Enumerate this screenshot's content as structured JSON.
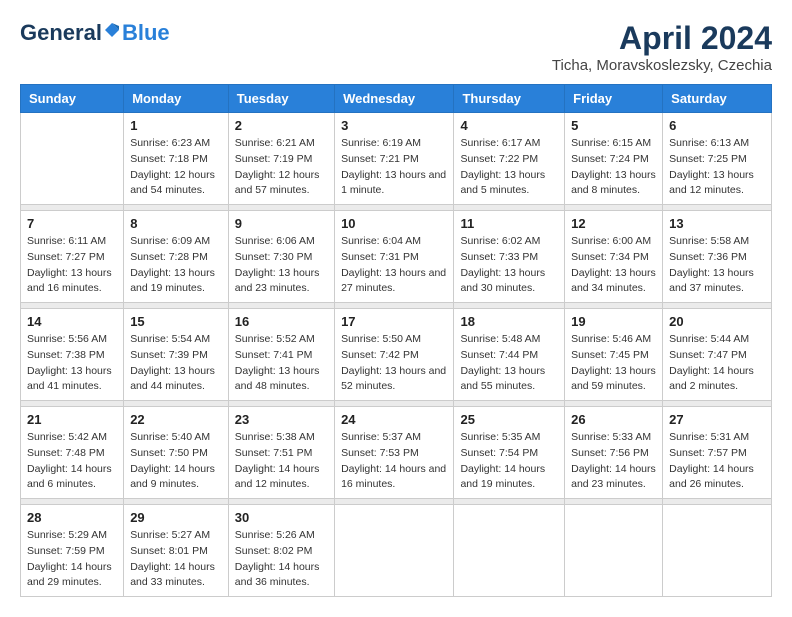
{
  "header": {
    "logo_general": "General",
    "logo_blue": "Blue",
    "month_title": "April 2024",
    "location": "Ticha, Moravskoslezsky, Czechia"
  },
  "days_of_week": [
    "Sunday",
    "Monday",
    "Tuesday",
    "Wednesday",
    "Thursday",
    "Friday",
    "Saturday"
  ],
  "weeks": [
    {
      "days": [
        {
          "number": "",
          "sunrise": "",
          "sunset": "",
          "daylight": ""
        },
        {
          "number": "1",
          "sunrise": "Sunrise: 6:23 AM",
          "sunset": "Sunset: 7:18 PM",
          "daylight": "Daylight: 12 hours and 54 minutes."
        },
        {
          "number": "2",
          "sunrise": "Sunrise: 6:21 AM",
          "sunset": "Sunset: 7:19 PM",
          "daylight": "Daylight: 12 hours and 57 minutes."
        },
        {
          "number": "3",
          "sunrise": "Sunrise: 6:19 AM",
          "sunset": "Sunset: 7:21 PM",
          "daylight": "Daylight: 13 hours and 1 minute."
        },
        {
          "number": "4",
          "sunrise": "Sunrise: 6:17 AM",
          "sunset": "Sunset: 7:22 PM",
          "daylight": "Daylight: 13 hours and 5 minutes."
        },
        {
          "number": "5",
          "sunrise": "Sunrise: 6:15 AM",
          "sunset": "Sunset: 7:24 PM",
          "daylight": "Daylight: 13 hours and 8 minutes."
        },
        {
          "number": "6",
          "sunrise": "Sunrise: 6:13 AM",
          "sunset": "Sunset: 7:25 PM",
          "daylight": "Daylight: 13 hours and 12 minutes."
        }
      ]
    },
    {
      "days": [
        {
          "number": "7",
          "sunrise": "Sunrise: 6:11 AM",
          "sunset": "Sunset: 7:27 PM",
          "daylight": "Daylight: 13 hours and 16 minutes."
        },
        {
          "number": "8",
          "sunrise": "Sunrise: 6:09 AM",
          "sunset": "Sunset: 7:28 PM",
          "daylight": "Daylight: 13 hours and 19 minutes."
        },
        {
          "number": "9",
          "sunrise": "Sunrise: 6:06 AM",
          "sunset": "Sunset: 7:30 PM",
          "daylight": "Daylight: 13 hours and 23 minutes."
        },
        {
          "number": "10",
          "sunrise": "Sunrise: 6:04 AM",
          "sunset": "Sunset: 7:31 PM",
          "daylight": "Daylight: 13 hours and 27 minutes."
        },
        {
          "number": "11",
          "sunrise": "Sunrise: 6:02 AM",
          "sunset": "Sunset: 7:33 PM",
          "daylight": "Daylight: 13 hours and 30 minutes."
        },
        {
          "number": "12",
          "sunrise": "Sunrise: 6:00 AM",
          "sunset": "Sunset: 7:34 PM",
          "daylight": "Daylight: 13 hours and 34 minutes."
        },
        {
          "number": "13",
          "sunrise": "Sunrise: 5:58 AM",
          "sunset": "Sunset: 7:36 PM",
          "daylight": "Daylight: 13 hours and 37 minutes."
        }
      ]
    },
    {
      "days": [
        {
          "number": "14",
          "sunrise": "Sunrise: 5:56 AM",
          "sunset": "Sunset: 7:38 PM",
          "daylight": "Daylight: 13 hours and 41 minutes."
        },
        {
          "number": "15",
          "sunrise": "Sunrise: 5:54 AM",
          "sunset": "Sunset: 7:39 PM",
          "daylight": "Daylight: 13 hours and 44 minutes."
        },
        {
          "number": "16",
          "sunrise": "Sunrise: 5:52 AM",
          "sunset": "Sunset: 7:41 PM",
          "daylight": "Daylight: 13 hours and 48 minutes."
        },
        {
          "number": "17",
          "sunrise": "Sunrise: 5:50 AM",
          "sunset": "Sunset: 7:42 PM",
          "daylight": "Daylight: 13 hours and 52 minutes."
        },
        {
          "number": "18",
          "sunrise": "Sunrise: 5:48 AM",
          "sunset": "Sunset: 7:44 PM",
          "daylight": "Daylight: 13 hours and 55 minutes."
        },
        {
          "number": "19",
          "sunrise": "Sunrise: 5:46 AM",
          "sunset": "Sunset: 7:45 PM",
          "daylight": "Daylight: 13 hours and 59 minutes."
        },
        {
          "number": "20",
          "sunrise": "Sunrise: 5:44 AM",
          "sunset": "Sunset: 7:47 PM",
          "daylight": "Daylight: 14 hours and 2 minutes."
        }
      ]
    },
    {
      "days": [
        {
          "number": "21",
          "sunrise": "Sunrise: 5:42 AM",
          "sunset": "Sunset: 7:48 PM",
          "daylight": "Daylight: 14 hours and 6 minutes."
        },
        {
          "number": "22",
          "sunrise": "Sunrise: 5:40 AM",
          "sunset": "Sunset: 7:50 PM",
          "daylight": "Daylight: 14 hours and 9 minutes."
        },
        {
          "number": "23",
          "sunrise": "Sunrise: 5:38 AM",
          "sunset": "Sunset: 7:51 PM",
          "daylight": "Daylight: 14 hours and 12 minutes."
        },
        {
          "number": "24",
          "sunrise": "Sunrise: 5:37 AM",
          "sunset": "Sunset: 7:53 PM",
          "daylight": "Daylight: 14 hours and 16 minutes."
        },
        {
          "number": "25",
          "sunrise": "Sunrise: 5:35 AM",
          "sunset": "Sunset: 7:54 PM",
          "daylight": "Daylight: 14 hours and 19 minutes."
        },
        {
          "number": "26",
          "sunrise": "Sunrise: 5:33 AM",
          "sunset": "Sunset: 7:56 PM",
          "daylight": "Daylight: 14 hours and 23 minutes."
        },
        {
          "number": "27",
          "sunrise": "Sunrise: 5:31 AM",
          "sunset": "Sunset: 7:57 PM",
          "daylight": "Daylight: 14 hours and 26 minutes."
        }
      ]
    },
    {
      "days": [
        {
          "number": "28",
          "sunrise": "Sunrise: 5:29 AM",
          "sunset": "Sunset: 7:59 PM",
          "daylight": "Daylight: 14 hours and 29 minutes."
        },
        {
          "number": "29",
          "sunrise": "Sunrise: 5:27 AM",
          "sunset": "Sunset: 8:01 PM",
          "daylight": "Daylight: 14 hours and 33 minutes."
        },
        {
          "number": "30",
          "sunrise": "Sunrise: 5:26 AM",
          "sunset": "Sunset: 8:02 PM",
          "daylight": "Daylight: 14 hours and 36 minutes."
        },
        {
          "number": "",
          "sunrise": "",
          "sunset": "",
          "daylight": ""
        },
        {
          "number": "",
          "sunrise": "",
          "sunset": "",
          "daylight": ""
        },
        {
          "number": "",
          "sunrise": "",
          "sunset": "",
          "daylight": ""
        },
        {
          "number": "",
          "sunrise": "",
          "sunset": "",
          "daylight": ""
        }
      ]
    }
  ]
}
